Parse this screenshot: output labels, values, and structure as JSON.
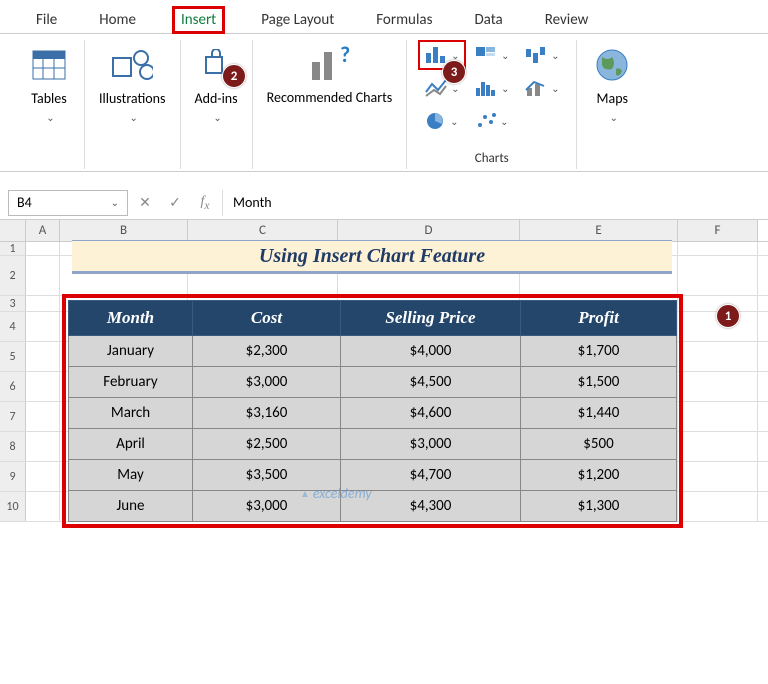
{
  "tabs": {
    "file": "File",
    "home": "Home",
    "insert": "Insert",
    "page_layout": "Page Layout",
    "formulas": "Formulas",
    "data": "Data",
    "review": "Review"
  },
  "ribbon": {
    "tables": "Tables",
    "illustrations": "Illustrations",
    "addins": "Add-ins",
    "recommended": "Recommended Charts",
    "charts_group": "Charts",
    "maps": "Maps"
  },
  "badges": {
    "b1": "1",
    "b2": "2",
    "b3": "3"
  },
  "namebox": "B4",
  "formula_value": "Month",
  "col_headers": {
    "A": "A",
    "B": "B",
    "C": "C",
    "D": "D",
    "E": "E",
    "F": "F"
  },
  "row_headers": [
    "1",
    "2",
    "3",
    "4",
    "5",
    "6",
    "7",
    "8",
    "9",
    "10"
  ],
  "banner_title": "Using Insert Chart Feature",
  "table": {
    "headers": {
      "month": "Month",
      "cost": "Cost",
      "price": "Selling Price",
      "profit": "Profit"
    },
    "rows": [
      {
        "month": "January",
        "cost": "$2,300",
        "price": "$4,000",
        "profit": "$1,700"
      },
      {
        "month": "February",
        "cost": "$3,000",
        "price": "$4,500",
        "profit": "$1,500"
      },
      {
        "month": "March",
        "cost": "$3,160",
        "price": "$4,600",
        "profit": "$1,440"
      },
      {
        "month": "April",
        "cost": "$2,500",
        "price": "$3,000",
        "profit": "$500"
      },
      {
        "month": "May",
        "cost": "$3,500",
        "price": "$4,700",
        "profit": "$1,200"
      },
      {
        "month": "June",
        "cost": "$3,000",
        "price": "$4,300",
        "profit": "$1,300"
      }
    ]
  },
  "watermark": "exceldemy"
}
